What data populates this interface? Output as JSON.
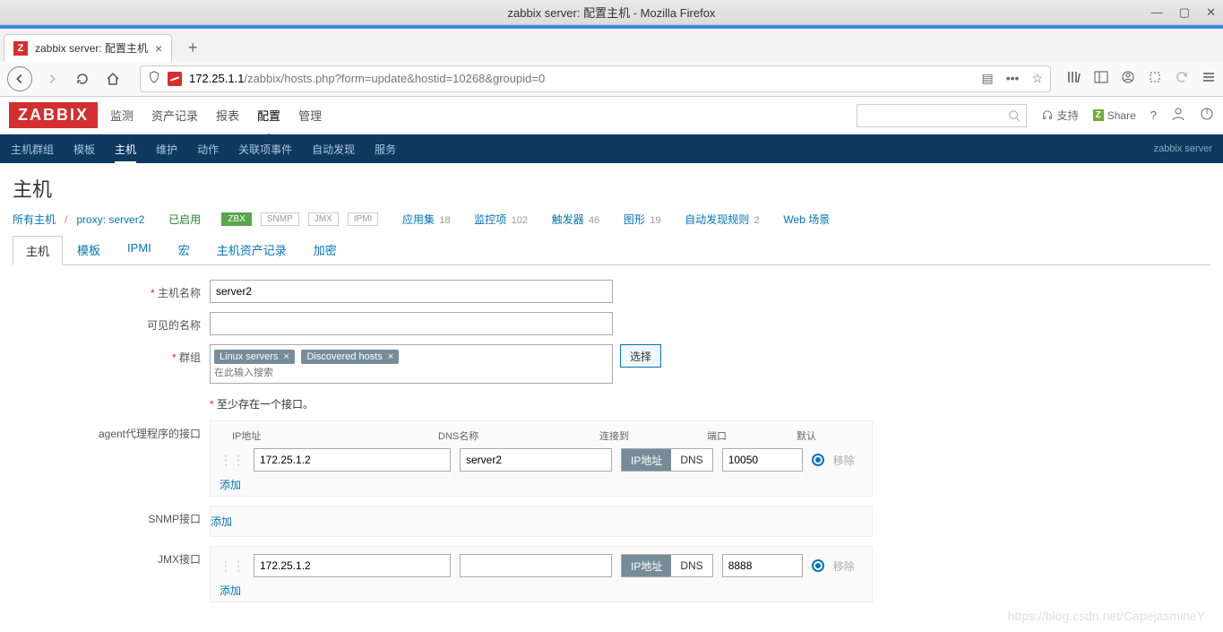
{
  "os": {
    "title": "zabbix server: 配置主机 - Mozilla Firefox",
    "min": "—",
    "max": "▢",
    "close": "✕"
  },
  "browser": {
    "tab_label": "zabbix server: 配置主机",
    "url_host": "172.25.1.1",
    "url_path": "/zabbix/hosts.php?form=update&hostid=10268&groupid=0"
  },
  "header": {
    "logo": "ZABBIX",
    "menu": [
      "监测",
      "资产记录",
      "报表",
      "配置",
      "管理"
    ],
    "menu_active": 3,
    "support": "支持",
    "share": "Share",
    "help": "?"
  },
  "submenu": {
    "items": [
      "主机群组",
      "模板",
      "主机",
      "维护",
      "动作",
      "关联项事件",
      "自动发现",
      "服务"
    ],
    "active": 2,
    "server": "zabbix server"
  },
  "page": {
    "title": "主机",
    "breadcrumb": {
      "all": "所有主机",
      "proxy": "proxy: server2"
    },
    "status": "已启用",
    "badges": {
      "zbx": "ZBX",
      "snmp": "SNMP",
      "jmx": "JMX",
      "ipmi": "IPMI"
    },
    "counters": {
      "apps_label": "应用集",
      "apps": "18",
      "items_label": "监控项",
      "items": "102",
      "triggers_label": "触发器",
      "triggers": "46",
      "graphs_label": "图形",
      "graphs": "19",
      "discovery_label": "自动发现规则",
      "discovery": "2",
      "web_label": "Web 场景"
    }
  },
  "tabs": [
    "主机",
    "模板",
    "IPMI",
    "宏",
    "主机资产记录",
    "加密"
  ],
  "tabs_active": 0,
  "form": {
    "hostname_label": "主机名称",
    "hostname": "server2",
    "visible_label": "可见的名称",
    "visible": "",
    "groups_label": "群组",
    "group_tags": [
      "Linux servers",
      "Discovered hosts"
    ],
    "groups_placeholder": "在此输入搜索",
    "select_btn": "选择",
    "iface_note": "至少存在一个接口。",
    "agent_label": "agent代理程序的接口",
    "snmp_label": "SNMP接口",
    "jmx_label": "JMX接口",
    "cols": {
      "ip": "IP地址",
      "dns": "DNS名称",
      "conn": "连接到",
      "port": "端口",
      "def": "默认"
    },
    "agent_if": {
      "ip": "172.25.1.2",
      "dns": "server2",
      "btn_ip": "IP地址",
      "btn_dns": "DNS",
      "port": "10050"
    },
    "jmx_if": {
      "ip": "172.25.1.2",
      "dns": "",
      "btn_ip": "IP地址",
      "btn_dns": "DNS",
      "port": "8888"
    },
    "add": "添加",
    "remove": "移除"
  },
  "watermark": "https://blog.csdn.net/CapejasmineY"
}
